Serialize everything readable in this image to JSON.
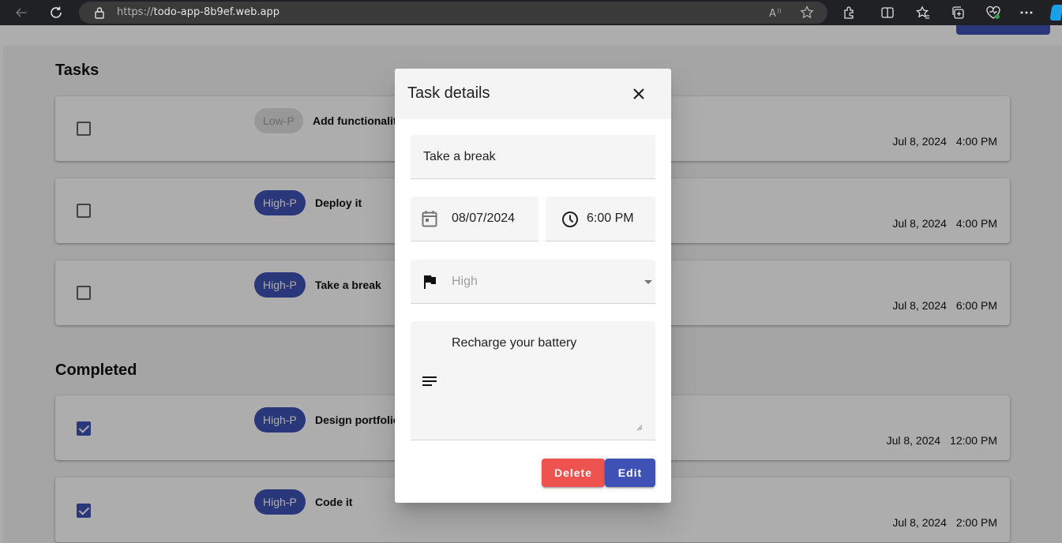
{
  "browser": {
    "url_protocol": "https://",
    "url_host": "todo-app-8b9ef.web.app"
  },
  "colors": {
    "primary": "#3f51b5",
    "danger": "#ef5350",
    "chrome": "#202124"
  },
  "tasks_section": {
    "title": "Tasks",
    "items": [
      {
        "priority": "Low-P",
        "title": "Add functionality",
        "date": "Jul 8, 2024",
        "time": "4:00 PM",
        "checked": false
      },
      {
        "priority": "High-P",
        "title": "Deploy it",
        "date": "Jul 8, 2024",
        "time": "4:00 PM",
        "checked": false
      },
      {
        "priority": "High-P",
        "title": "Take a break",
        "date": "Jul 8, 2024",
        "time": "6:00 PM",
        "checked": false
      }
    ]
  },
  "completed_section": {
    "title": "Completed",
    "items": [
      {
        "priority": "High-P",
        "title": "Design portfolio",
        "date": "Jul 8, 2024",
        "time": "12:00 PM",
        "checked": true
      },
      {
        "priority": "High-P",
        "title": "Code it",
        "date": "Jul 8, 2024",
        "time": "2:00 PM",
        "checked": true
      }
    ]
  },
  "dialog": {
    "title": "Task details",
    "task_name": "Take a break",
    "date": "08/07/2024",
    "time": "6:00 PM",
    "priority": "High",
    "description": "Recharge your battery",
    "delete_label": "Delete",
    "edit_label": "Edit"
  },
  "icons": [
    "back-arrow-icon",
    "refresh-icon",
    "lock-icon",
    "read-aloud-icon",
    "favorite-star-icon",
    "extensions-icon",
    "split-screen-icon",
    "favorites-icon",
    "collections-icon",
    "health-icon",
    "more-icon",
    "calendar-icon",
    "clock-icon",
    "flag-icon",
    "notes-icon",
    "close-icon"
  ]
}
